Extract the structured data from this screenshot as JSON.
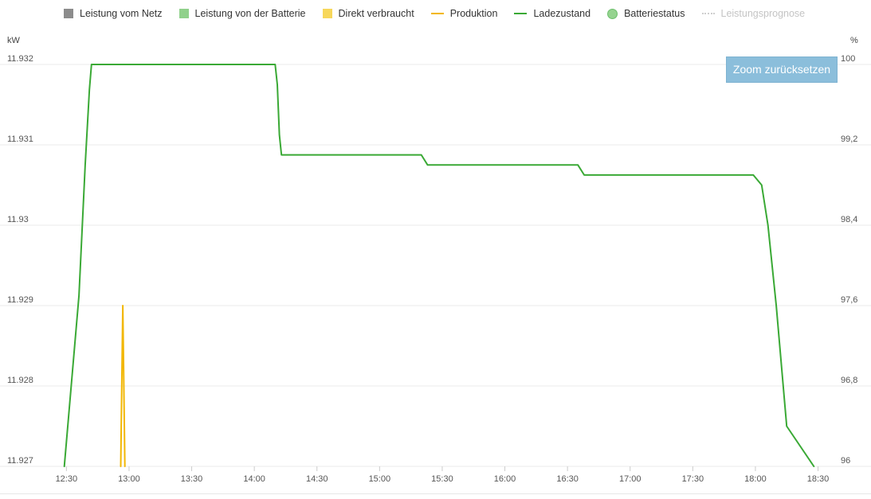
{
  "legend": [
    {
      "label": "Leistung vom Netz",
      "symbol": "square",
      "color": "#8c8c8c",
      "dim": false,
      "icon": "square-icon"
    },
    {
      "label": "Leistung von der Batterie",
      "symbol": "square",
      "color": "#90d18b",
      "dim": false,
      "icon": "square-icon"
    },
    {
      "label": "Direkt verbraucht",
      "symbol": "square",
      "color": "#f7d75b",
      "dim": false,
      "icon": "square-icon"
    },
    {
      "label": "Produktion",
      "symbol": "line",
      "color": "#f2b705",
      "dim": false,
      "icon": "line-icon"
    },
    {
      "label": "Ladezustand",
      "symbol": "line",
      "color": "#3aa935",
      "dim": false,
      "icon": "line-icon"
    },
    {
      "label": "Batteriestatus",
      "symbol": "dot",
      "color": "#95d38f",
      "dim": false,
      "icon": "circle-icon"
    },
    {
      "label": "Leistungsprognose",
      "symbol": "dotted",
      "color": "#cfcfcf",
      "dim": true,
      "icon": "dotted-line-icon"
    }
  ],
  "axis_units": {
    "left": "kW",
    "right": "%"
  },
  "zoom_button": {
    "label": "Zoom zurücksetzen"
  },
  "chart_data": {
    "type": "line",
    "x_tick_labels": [
      "12:30",
      "13:00",
      "13:30",
      "14:00",
      "14:30",
      "15:00",
      "15:30",
      "16:00",
      "16:30",
      "17:00",
      "17:30",
      "18:00",
      "18:30"
    ],
    "y_left": {
      "label": "kW",
      "range": [
        11.927,
        11.932
      ],
      "ticks": [
        11.927,
        11.928,
        11.929,
        11.93,
        11.931,
        11.932
      ],
      "tick_labels": [
        "11.927",
        "11.928",
        "11.929",
        "11.93",
        "11.931",
        "11.932"
      ]
    },
    "y_right": {
      "label": "%",
      "range": [
        96,
        100
      ],
      "ticks": [
        96,
        96.8,
        97.6,
        98.4,
        99.2,
        100
      ],
      "tick_labels": [
        "96",
        "96,8",
        "97,6",
        "98,4",
        "99,2",
        "100"
      ]
    },
    "grid": true,
    "legend_position": "top",
    "series": [
      {
        "name": "Ladezustand",
        "axis": "right",
        "color": "#3aa935",
        "points": [
          [
            "12:29",
            96.0
          ],
          [
            "12:36",
            97.7
          ],
          [
            "12:39",
            99.0
          ],
          [
            "12:41",
            99.75
          ],
          [
            "12:42",
            100.0
          ],
          [
            "14:10",
            100.0
          ],
          [
            "14:11",
            99.8
          ],
          [
            "14:12",
            99.3
          ],
          [
            "14:13",
            99.1
          ],
          [
            "14:14",
            99.1
          ],
          [
            "15:20",
            99.1
          ],
          [
            "15:23",
            99.0
          ],
          [
            "15:25",
            99.0
          ],
          [
            "16:35",
            99.0
          ],
          [
            "16:38",
            98.9
          ],
          [
            "16:40",
            98.9
          ],
          [
            "17:59",
            98.9
          ],
          [
            "18:03",
            98.8
          ],
          [
            "18:06",
            98.4
          ],
          [
            "18:10",
            97.6
          ],
          [
            "18:15",
            96.4
          ],
          [
            "18:28",
            96.0
          ]
        ]
      },
      {
        "name": "Produktion",
        "axis": "left",
        "color": "#f2b705",
        "points": [
          [
            "12:56",
            11.927
          ],
          [
            "12:57",
            11.929
          ],
          [
            "12:58",
            11.927
          ]
        ]
      }
    ]
  }
}
